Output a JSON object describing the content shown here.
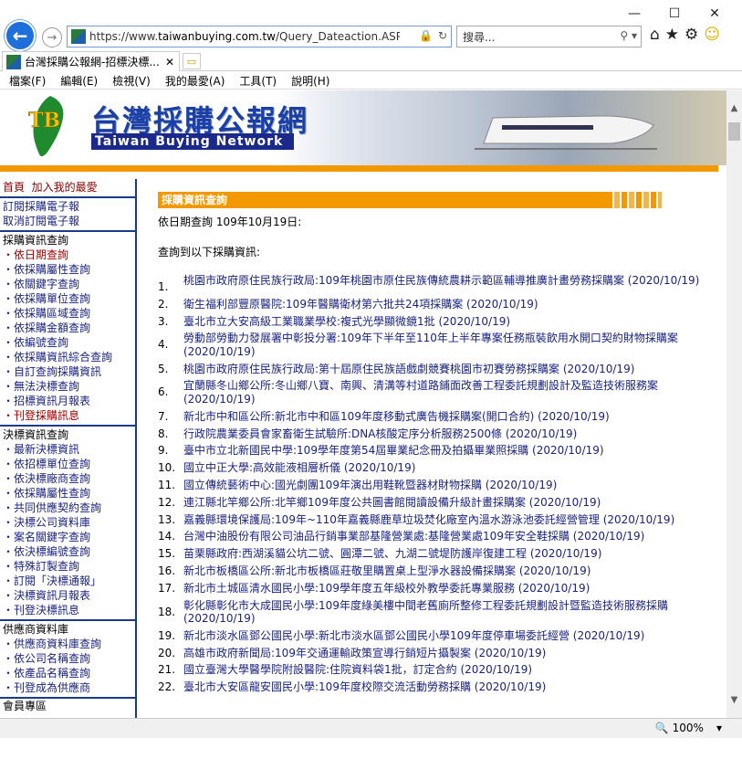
{
  "browser": {
    "url_prefix": "https://www.",
    "url_domain": "taiwanbuying.com.tw",
    "url_path": "/Query_Dateaction.ASP?yy",
    "search_placeholder": "搜尋...",
    "tab_title": "台灣採購公報網-招標決標...",
    "menu": [
      "檔案(F)",
      "編輯(E)",
      "檢視(V)",
      "我的最愛(A)",
      "工具(T)",
      "說明(H)"
    ],
    "zoom": "100%"
  },
  "banner": {
    "logo_letters": "TB",
    "title_zh": "台灣採購公報網",
    "title_en": "Taiwan Buying Network"
  },
  "sidebar": {
    "top": [
      "首頁",
      "加入我的最愛"
    ],
    "subscribe": [
      "訂閱採購電子報",
      "取消訂閱電子報"
    ],
    "procurement_head": "採購資訊查詢",
    "procurement": [
      "依日期查詢",
      "依採購屬性查詢",
      "依關鍵字查詢",
      "依採購單位查詢",
      "依採購區域查詢",
      "依採購金額查詢",
      "依編號查詢",
      "依採購資訊綜合查詢",
      "自訂查詢採購資訊",
      "無法決標查詢",
      "招標資訊月報表",
      "刊登採購訊息"
    ],
    "award_head": "決標資訊查詢",
    "award": [
      "最新決標資訊",
      "依招標單位查詢",
      "依決標廠商查詢",
      "依採購屬性查詢",
      "共同供應契約查詢",
      "決標公司資料庫",
      "案名關鍵字查詢",
      "依決標編號查詢",
      "特殊訂製查詢",
      "訂閱「決標通報」",
      "決標資訊月報表",
      "刊登決標訊息"
    ],
    "supplier_head": "供應商資料庫",
    "supplier": [
      "供應商資料庫查詢",
      "依公司名稱查詢",
      "依產品名稱查詢",
      "刊登成為供應商"
    ],
    "member_head": "會員專區"
  },
  "content": {
    "section_title": "採購資訊查詢",
    "query_line": "依日期查詢 109年10月19日:",
    "result_line": "查詢到以下採購資訊:",
    "results": [
      "桃園市政府原住民族行政局:109年桃園市原住民族傳統農耕示範區輔導推廣計畫勞務採購案 (2020/10/19)",
      "衛生福利部豐原醫院:109年醫購衛材第六批共24項採購案 (2020/10/19)",
      "臺北市立大安高級工業職業學校:複式光學顯微鏡1批 (2020/10/19)",
      "勞動部勞動力發展署中彰投分署:109年下半年至110年上半年專案任務瓶裝飲用水開口契約財物採購案 (2020/10/19)",
      "桃園市政府原住民族行政局:第十屆原住民族語戲劇競賽桃園市初賽勞務採購案 (2020/10/19)",
      "宜蘭縣冬山鄉公所:冬山鄉八寶、南興、清溝等村道路鋪面改善工程委託規劃設計及監造技術服務案 (2020/10/19)",
      "新北市中和區公所:新北市中和區109年度移動式廣告機採購案(開口合約) (2020/10/19)",
      "行政院農業委員會家畜衛生試驗所:DNA核酸定序分析服務2500條 (2020/10/19)",
      "臺中市立北新國民中學:109學年度第54屆畢業紀念冊及拍攝畢業照採購 (2020/10/19)",
      "國立中正大學:高效能液相層析儀 (2020/10/19)",
      "國立傳統藝術中心:國光劇團109年演出用鞋靴暨器材財物採購 (2020/10/19)",
      "連江縣北竿鄉公所:北竿鄉109年度公共圖書館閱讀設備升級計畫採購案 (2020/10/19)",
      "嘉義縣環境保護局:109年~110年嘉義縣鹿草垃圾焚化廠室內溫水游泳池委託經營管理 (2020/10/19)",
      "台灣中油股份有限公司油品行銷事業部基隆營業處:基隆營業處109年安全鞋採購 (2020/10/19)",
      "苗栗縣政府:西湖溪貓公坑二號、圓潭二號、九湖二號堤防護岸復建工程 (2020/10/19)",
      "新北市板橋區公所:新北市板橋區莊敬里購置桌上型淨水器設備採購案 (2020/10/19)",
      "新北市土城區清水國民小學:109學年度五年級校外教學委託專業服務 (2020/10/19)",
      "彰化縣彰化市大成國民小學:109年度綠美樓中間老舊廁所整修工程委託規劃設計暨監造技術服務採購 (2020/10/19)",
      "新北市淡水區鄧公國民小學:新北市淡水區鄧公國民小學109年度停車場委託經營 (2020/10/19)",
      "高雄市政府新聞局:109年交通運輸政策宣導行銷短片攝製案 (2020/10/19)",
      "國立臺灣大學醫學院附設醫院:住院資料袋1批，訂定合約 (2020/10/19)",
      "臺北市大安區龍安國民小學:109年度校際交流活動勞務採購 (2020/10/19)"
    ],
    "result_numbers": [
      "1.",
      "2.",
      "3.",
      "4.",
      "5.",
      "6.",
      "7.",
      "8.",
      "9.",
      "10.",
      "11.",
      "12.",
      "13.",
      "14.",
      "15.",
      "16.",
      "17.",
      "18.",
      "19.",
      "20.",
      "21.",
      "22."
    ]
  }
}
